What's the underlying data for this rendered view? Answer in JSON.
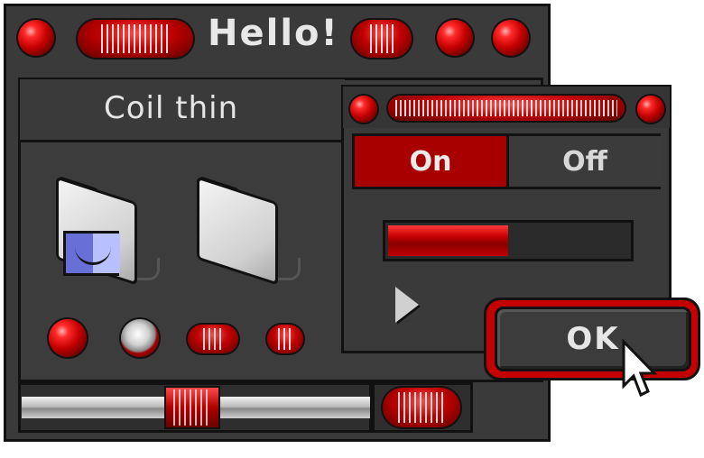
{
  "main_window": {
    "title": "Hello!",
    "header_label": "Coil thin"
  },
  "dialog": {
    "toggle": {
      "on_label": "On",
      "off_label": "Off",
      "selected": "On"
    },
    "progress_fraction": 0.5,
    "ok_label": "OK"
  },
  "slider": {
    "value_fraction": 0.5
  },
  "icons": {
    "folder_1": "finder-folder-icon",
    "folder_2": "folder-icon",
    "cursor": "arrow-cursor-icon"
  },
  "colors": {
    "accent_red": "#c00000",
    "window_bg": "#3a3a3a"
  }
}
